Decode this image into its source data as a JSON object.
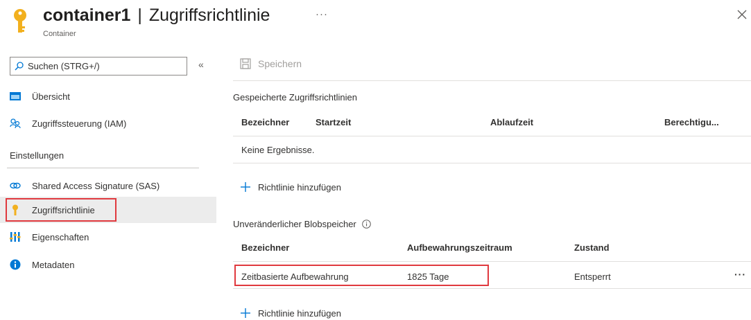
{
  "header": {
    "resource_name": "container1",
    "separator": "|",
    "page_name": "Zugriffsrichtlinie",
    "subtitle": "Container",
    "more": "···",
    "icon": "key-icon",
    "close_icon": "close-icon"
  },
  "sidebar": {
    "search_placeholder": "Suchen (STRG+/)",
    "collapse": "«",
    "items": [
      {
        "label": "Übersicht",
        "icon": "overview-icon"
      },
      {
        "label": "Zugriffssteuerung (IAM)",
        "icon": "people-icon"
      }
    ],
    "section_label": "Einstellungen",
    "settings_items": [
      {
        "label": "Shared Access Signature (SAS)",
        "icon": "link-icon"
      },
      {
        "label": "Zugriffsrichtlinie",
        "icon": "key-icon",
        "active": true
      },
      {
        "label": "Eigenschaften",
        "icon": "properties-icon"
      },
      {
        "label": "Metadaten",
        "icon": "info-icon"
      }
    ]
  },
  "toolbar": {
    "save_label": "Speichern"
  },
  "stored_policies": {
    "title": "Gespeicherte Zugriffsrichtlinien",
    "columns": [
      "Bezeichner",
      "Startzeit",
      "Ablaufzeit",
      "Berechtigu..."
    ],
    "empty_text": "Keine Ergebnisse.",
    "add_label": "Richtlinie hinzufügen"
  },
  "immutable_storage": {
    "title": "Unveränderlicher Blobspeicher",
    "columns": [
      "Bezeichner",
      "Aufbewahrungszeitraum",
      "Zustand"
    ],
    "rows": [
      {
        "identifier": "Zeitbasierte Aufbewahrung",
        "retention": "1825 Tage",
        "state": "Entsperrt",
        "more": "···"
      }
    ],
    "add_label": "Richtlinie hinzufügen"
  },
  "colors": {
    "accent": "#0078d4",
    "key_yellow": "#f2b01e",
    "highlight_red": "#e0393e",
    "active_bg": "#ececec"
  }
}
